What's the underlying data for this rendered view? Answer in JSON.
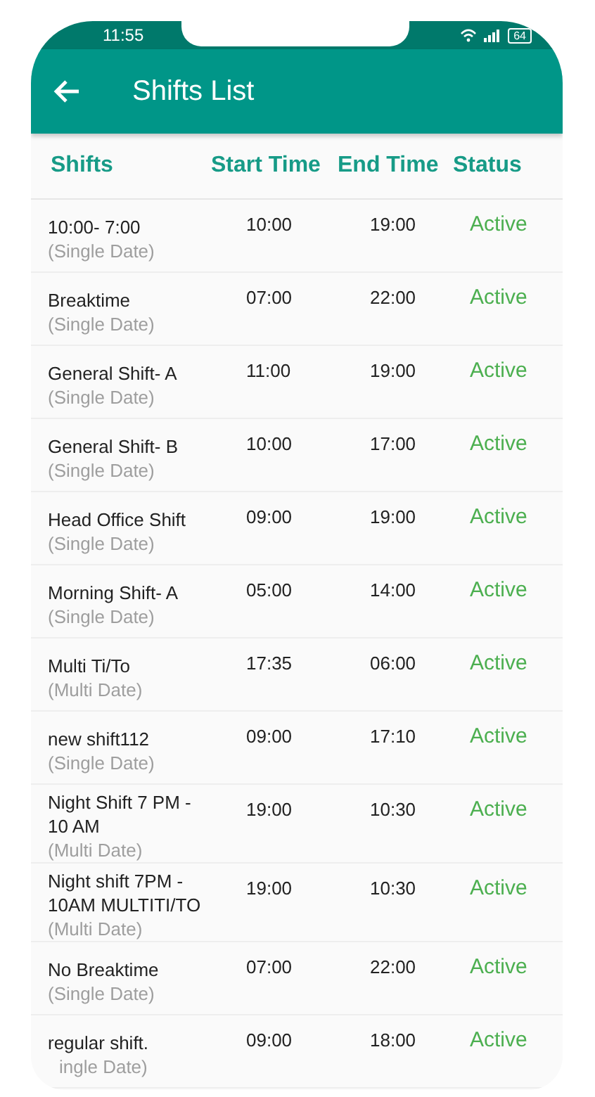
{
  "status_bar": {
    "time": "11:55",
    "battery": "64"
  },
  "app_bar": {
    "title": "Shifts List"
  },
  "table": {
    "columns": [
      "Shifts",
      "Start Time",
      "End Time",
      "Status"
    ],
    "rows": [
      {
        "name": "10:00- 7:00",
        "type": "(Single Date)",
        "start": "10:00",
        "end": "19:00",
        "status": "Active"
      },
      {
        "name": "Breaktime",
        "type": "(Single Date)",
        "start": "07:00",
        "end": "22:00",
        "status": "Active"
      },
      {
        "name": "General Shift- A",
        "type": "(Single Date)",
        "start": "11:00",
        "end": "19:00",
        "status": "Active"
      },
      {
        "name": "General Shift- B",
        "type": "(Single Date)",
        "start": "10:00",
        "end": "17:00",
        "status": "Active"
      },
      {
        "name": "Head Office Shift",
        "type": "(Single Date)",
        "start": "09:00",
        "end": "19:00",
        "status": "Active"
      },
      {
        "name": "Morning Shift- A",
        "type": "(Single Date)",
        "start": "05:00",
        "end": "14:00",
        "status": "Active"
      },
      {
        "name": "Multi Ti/To",
        "type": "(Multi Date)",
        "start": "17:35",
        "end": "06:00",
        "status": "Active"
      },
      {
        "name": "new shift112",
        "type": "(Single Date)",
        "start": "09:00",
        "end": "17:10",
        "status": "Active"
      },
      {
        "name": "Night Shift 7 PM - 10 AM",
        "type": "(Multi Date)",
        "start": "19:00",
        "end": "10:30",
        "status": "Active"
      },
      {
        "name": "Night shift 7PM - 10AM MULTITI/TO",
        "type": "(Multi Date)",
        "start": "19:00",
        "end": "10:30",
        "status": "Active"
      },
      {
        "name": "No Breaktime",
        "type": "(Single Date)",
        "start": "07:00",
        "end": "22:00",
        "status": "Active"
      },
      {
        "name": "regular shift.",
        "type": "ingle Date)",
        "start": "09:00",
        "end": "18:00",
        "status": "Active"
      }
    ]
  }
}
